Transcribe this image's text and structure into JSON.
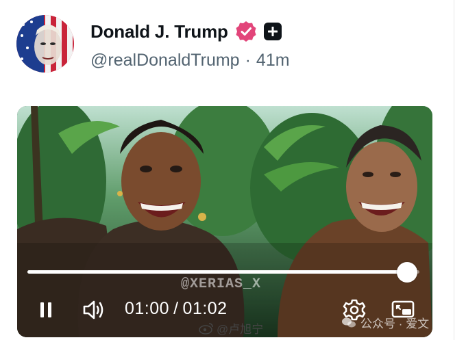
{
  "post": {
    "display_name": "Donald J. Trump",
    "handle": "@realDonaldTrump",
    "separator": "·",
    "age": "41m",
    "verified_color": "#e2457a"
  },
  "video": {
    "watermark": "@XERIAS_X",
    "current_time": "01:00",
    "duration": "01:02",
    "time_separator": "/",
    "progress": 0.968,
    "state": "playing"
  },
  "credits": {
    "weibo": "@卢旭宁",
    "wechat": "公众号 · 爱文"
  },
  "icons": {
    "verified": "verified-badge-icon",
    "plus": "subscription-plus-icon",
    "pause": "pause-icon",
    "volume": "volume-icon",
    "settings": "gear-icon",
    "pip": "picture-in-picture-icon"
  }
}
